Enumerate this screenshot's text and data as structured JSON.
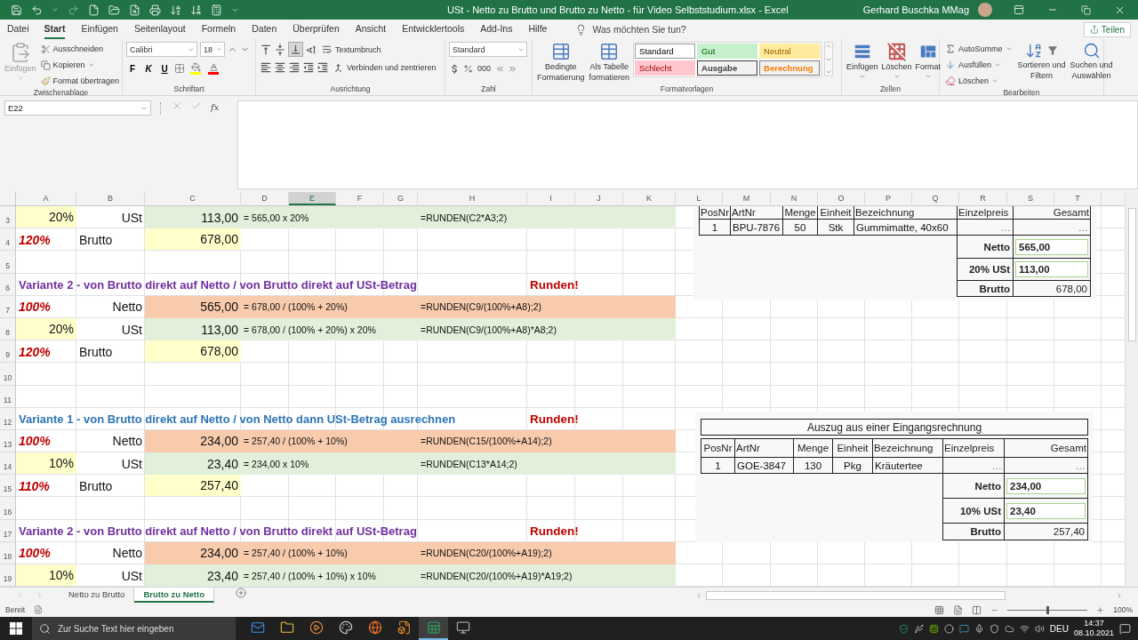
{
  "title_bar": {
    "title": "USt - Netto zu Brutto und Brutto zu Netto - für Video Selbststudium.xlsx  -  Excel",
    "user": "Gerhard Buschka MMag"
  },
  "menu_tabs": [
    {
      "label": "Datei",
      "selected": false
    },
    {
      "label": "Start",
      "selected": true
    },
    {
      "label": "Einfügen",
      "selected": false
    },
    {
      "label": "Seitenlayout",
      "selected": false
    },
    {
      "label": "Formeln",
      "selected": false
    },
    {
      "label": "Daten",
      "selected": false
    },
    {
      "label": "Überprüfen",
      "selected": false
    },
    {
      "label": "Ansicht",
      "selected": false
    },
    {
      "label": "Entwicklertools",
      "selected": false
    },
    {
      "label": "Add-Ins",
      "selected": false
    },
    {
      "label": "Hilfe",
      "selected": false
    }
  ],
  "tell_me": {
    "placeholder": "Was möchten Sie tun?"
  },
  "share_button": "Teilen",
  "ribbon": {
    "clipboard": {
      "label": "Zwischenablage",
      "paste": "Einfügen",
      "cut": "Ausschneiden",
      "copy": "Kopieren",
      "format_painter": "Format übertragen"
    },
    "font": {
      "label": "Schriftart",
      "font_name": "Calibri",
      "font_size": "18",
      "bold": "F",
      "italic": "K",
      "underline": "U"
    },
    "alignment": {
      "label": "Ausrichtung",
      "wrap_text": "Textumbruch",
      "merge": "Verbinden und zentrieren"
    },
    "number": {
      "label": "Zahl",
      "format": "Standard",
      "thousands": "000"
    },
    "styles": {
      "label": "Formatvorlagen",
      "conditional": [
        "Bedingte",
        "Formatierung"
      ],
      "as_table": [
        "Als Tabelle",
        "formatieren"
      ],
      "cell_styles": [
        {
          "label": "Standard",
          "kind": "normal"
        },
        {
          "label": "Gut",
          "kind": "good"
        },
        {
          "label": "Neutral",
          "kind": "neutral"
        },
        {
          "label": "Schlecht",
          "kind": "bad"
        },
        {
          "label": "Ausgabe",
          "kind": "output"
        },
        {
          "label": "Berechnung",
          "kind": "calculation"
        }
      ]
    },
    "cells": {
      "label": "Zellen",
      "insert": "Einfügen",
      "delete": "Löschen",
      "format": "Format"
    },
    "editing": {
      "label": "Bearbeiten",
      "autosum": "AutoSumme",
      "fill": "Ausfüllen",
      "clear": "Löschen",
      "sort": [
        "Sortieren und",
        "Filtern"
      ],
      "find": [
        "Suchen und",
        "Auswählen"
      ]
    }
  },
  "name_box": "E22",
  "fx_label": "fx",
  "columns": [
    {
      "label": "A",
      "selected": false
    },
    {
      "label": "B",
      "selected": false
    },
    {
      "label": "C",
      "selected": false
    },
    {
      "label": "D",
      "selected": false
    },
    {
      "label": "E",
      "selected": true
    },
    {
      "label": "F",
      "selected": false
    },
    {
      "label": "G",
      "selected": false
    },
    {
      "label": "H",
      "selected": false
    },
    {
      "label": "I",
      "selected": false
    },
    {
      "label": "J",
      "selected": false
    },
    {
      "label": "K",
      "selected": false
    },
    {
      "label": "L",
      "selected": false
    },
    {
      "label": "M",
      "selected": false
    },
    {
      "label": "N",
      "selected": false
    },
    {
      "label": "O",
      "selected": false
    },
    {
      "label": "P",
      "selected": false
    },
    {
      "label": "Q",
      "selected": false
    },
    {
      "label": "R",
      "selected": false
    },
    {
      "label": "S",
      "selected": false
    },
    {
      "label": "T",
      "selected": false
    }
  ],
  "rows": [
    {
      "number": "3",
      "kind": "ust",
      "A": {
        "text": "20%",
        "kind": "pct_input"
      },
      "B": {
        "text": "USt",
        "kind": "label_right"
      },
      "C": {
        "text": "113,00",
        "kind": "amount"
      },
      "D": {
        "text": "= 565,00 x 20%",
        "kind": "note"
      },
      "H": {
        "text": "=RUNDEN(C2*A3;2)",
        "kind": "formula"
      }
    },
    {
      "number": "4",
      "kind": "plain",
      "A": {
        "text": "120%",
        "kind": "pct_red"
      },
      "B": {
        "text": "Brutto",
        "kind": "label_left"
      },
      "C": {
        "text": "678,00",
        "kind": "amount_input"
      }
    },
    {
      "number": "5",
      "kind": "plain"
    },
    {
      "number": "6",
      "kind": "plain",
      "A": {
        "text": "Variante 2 - von Brutto direkt auf Netto / von Brutto direkt auf USt-Betrag",
        "kind": "heading",
        "color": "#7030a0"
      },
      "I": {
        "text": "Runden!",
        "kind": "alert"
      }
    },
    {
      "number": "7",
      "kind": "netto",
      "A": {
        "text": "100%",
        "kind": "pct_red"
      },
      "B": {
        "text": "Netto",
        "kind": "label_right"
      },
      "C": {
        "text": "565,00",
        "kind": "amount"
      },
      "D": {
        "text": "= 678,00 / (100% + 20%)",
        "kind": "note"
      },
      "H": {
        "text": "=RUNDEN(C9/(100%+A8);2)",
        "kind": "formula"
      }
    },
    {
      "number": "8",
      "kind": "ust",
      "A": {
        "text": "20%",
        "kind": "pct_input"
      },
      "B": {
        "text": "USt",
        "kind": "label_right"
      },
      "C": {
        "text": "113,00",
        "kind": "amount"
      },
      "D": {
        "text": "= 678,00 / (100% + 20%) x 20%",
        "kind": "note"
      },
      "H": {
        "text": "=RUNDEN(C9/(100%+A8)*A8;2)",
        "kind": "formula"
      }
    },
    {
      "number": "9",
      "kind": "plain",
      "A": {
        "text": "120%",
        "kind": "pct_red"
      },
      "B": {
        "text": "Brutto",
        "kind": "label_left"
      },
      "C": {
        "text": "678,00",
        "kind": "amount_input"
      }
    },
    {
      "number": "10",
      "kind": "plain"
    },
    {
      "number": "11",
      "kind": "plain"
    },
    {
      "number": "12",
      "kind": "plain",
      "A": {
        "text": "Variante 1 - von Brutto direkt auf Netto / von Netto dann USt-Betrag ausrechnen",
        "kind": "heading",
        "color": "#2e75b6"
      },
      "I": {
        "text": "Runden!",
        "kind": "alert"
      }
    },
    {
      "number": "13",
      "kind": "netto",
      "A": {
        "text": "100%",
        "kind": "pct_red"
      },
      "B": {
        "text": "Netto",
        "kind": "label_right"
      },
      "C": {
        "text": "234,00",
        "kind": "amount"
      },
      "D": {
        "text": "= 257,40 / (100% + 10%)",
        "kind": "note"
      },
      "H": {
        "text": "=RUNDEN(C15/(100%+A14);2)",
        "kind": "formula"
      }
    },
    {
      "number": "14",
      "kind": "ust",
      "A": {
        "text": "10%",
        "kind": "pct_input"
      },
      "B": {
        "text": "USt",
        "kind": "label_right"
      },
      "C": {
        "text": "23,40",
        "kind": "amount"
      },
      "D": {
        "text": "= 234,00 x 10%",
        "kind": "note"
      },
      "H": {
        "text": "=RUNDEN(C13*A14;2)",
        "kind": "formula"
      }
    },
    {
      "number": "15",
      "kind": "plain",
      "A": {
        "text": "110%",
        "kind": "pct_red"
      },
      "B": {
        "text": "Brutto",
        "kind": "label_left"
      },
      "C": {
        "text": "257,40",
        "kind": "amount_input"
      }
    },
    {
      "number": "16",
      "kind": "plain"
    },
    {
      "number": "17",
      "kind": "plain",
      "A": {
        "text": "Variante 2 - von Brutto direkt auf Netto / von Brutto direkt auf USt-Betrag",
        "kind": "heading",
        "color": "#7030a0"
      },
      "I": {
        "text": "Runden!",
        "kind": "alert"
      }
    },
    {
      "number": "18",
      "kind": "netto",
      "A": {
        "text": "100%",
        "kind": "pct_red"
      },
      "B": {
        "text": "Netto",
        "kind": "label_right"
      },
      "C": {
        "text": "234,00",
        "kind": "amount"
      },
      "D": {
        "text": "= 257,40 / (100% + 10%)",
        "kind": "note"
      },
      "H": {
        "text": "=RUNDEN(C20/(100%+A19);2)",
        "kind": "formula"
      }
    },
    {
      "number": "19",
      "kind": "ust",
      "A": {
        "text": "10%",
        "kind": "pct_input"
      },
      "B": {
        "text": "USt",
        "kind": "label_right"
      },
      "C": {
        "text": "23,40",
        "kind": "amount"
      },
      "D": {
        "text": "= 257,40 / (100% + 10%) x 10%",
        "kind": "note"
      },
      "H": {
        "text": "=RUNDEN(C20/(100%+A19)*A19;2)",
        "kind": "formula"
      }
    }
  ],
  "invoices": [
    {
      "columns": [
        "PosNr",
        "ArtNr",
        "Menge",
        "Einheit",
        "Bezeichnung",
        "Einzelpreis",
        "Gesamt"
      ],
      "items": [
        [
          "1",
          "BPU-7876",
          "50",
          "Stk",
          "Gummimatte, 40x60",
          "…",
          "…"
        ]
      ],
      "totals": [
        {
          "label": "Netto",
          "value": "565,00",
          "kind": "result"
        },
        {
          "label": "20% USt",
          "value": "113,00",
          "kind": "result"
        },
        {
          "label": "Brutto",
          "value": "678,00",
          "kind": "plain"
        }
      ]
    },
    {
      "title": "Auszug aus einer Eingangsrechnung",
      "columns": [
        "PosNr",
        "ArtNr",
        "Menge",
        "Einheit",
        "Bezeichnung",
        "Einzelpreis",
        "Gesamt"
      ],
      "items": [
        [
          "1",
          "GOE-3847",
          "130",
          "Pkg",
          "Kräutertee",
          "…",
          "…"
        ]
      ],
      "totals": [
        {
          "label": "Netto",
          "value": "234,00",
          "kind": "result"
        },
        {
          "label": "10% USt",
          "value": "23,40",
          "kind": "result"
        },
        {
          "label": "Brutto",
          "value": "257,40",
          "kind": "plain"
        }
      ]
    }
  ],
  "sheet_tabs": [
    {
      "label": "Netto zu Brutto",
      "selected": false
    },
    {
      "label": "Brutto zu Netto",
      "selected": true
    }
  ],
  "status": "Bereit",
  "zoom": {
    "level": 0.5,
    "reading": "100%"
  },
  "taskbar": {
    "search": {
      "placeholder": "Zur Suche Text hier eingeben"
    },
    "language": "DEU",
    "time": "14:37",
    "date": "08.10.2021"
  }
}
